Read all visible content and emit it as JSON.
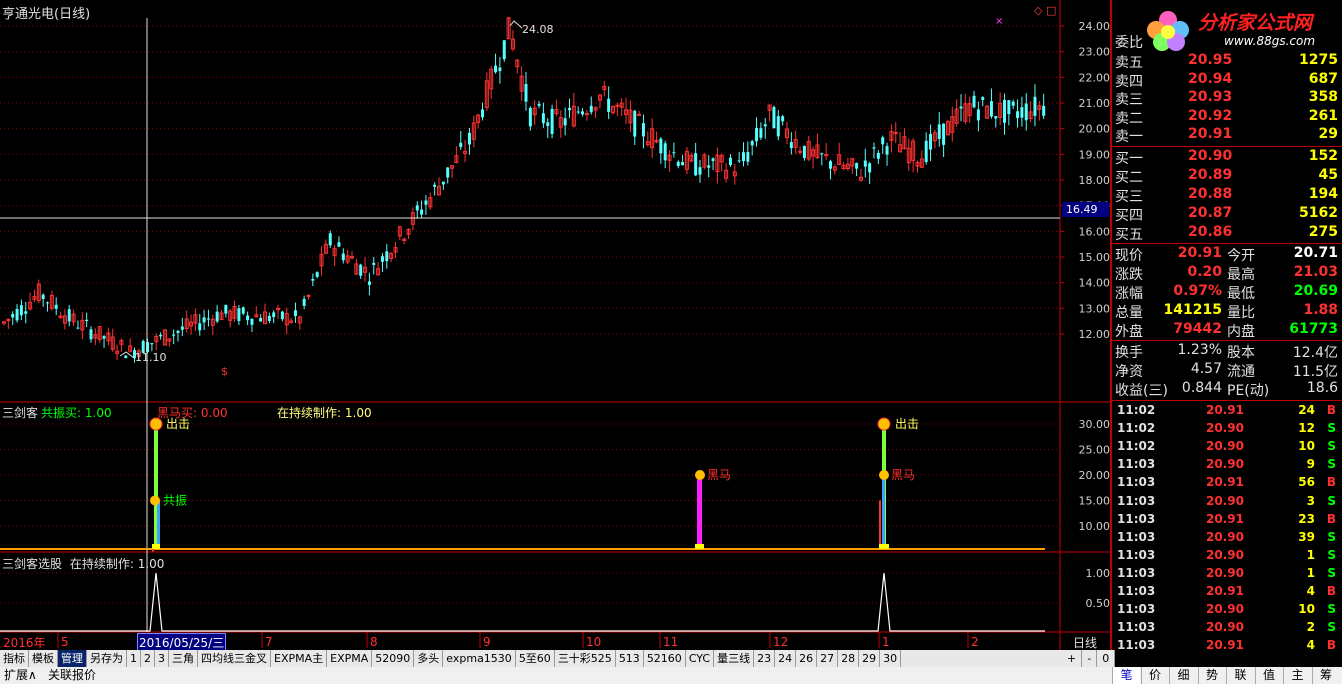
{
  "window": {
    "stock_title": "亨通光电(日线)",
    "right_marks": "◇ □",
    "logo_text": "分析家公式网",
    "logo_url": "www.88gs.com"
  },
  "price_chart": {
    "y_ticks": [
      "24.00",
      "23.00",
      "22.00",
      "21.00",
      "20.00",
      "19.00",
      "18.00",
      "17.00",
      "16.00",
      "15.00",
      "14.00",
      "13.00",
      "12.00"
    ],
    "cursor_price": "16.49",
    "high_label": "24.08",
    "low_label": "11.10",
    "dollar_mark": "$"
  },
  "ind1": {
    "name": "三剑客",
    "lines": [
      {
        "label": "共振买:",
        "value": "1.00"
      },
      {
        "label": "黑马买:",
        "value": "0.00"
      },
      {
        "label": "在持续制作:",
        "value": "1.00"
      }
    ],
    "y_ticks": [
      "30.00",
      "25.00",
      "20.00",
      "15.00",
      "10.00"
    ],
    "signals": [
      "出击",
      "共振",
      "黑马",
      "出击",
      "黑马"
    ]
  },
  "ind2": {
    "name": "三剑客选股",
    "line_label": "在持续制作:",
    "line_value": "1.00",
    "y_ticks": [
      "1.00",
      "0.50"
    ]
  },
  "date_axis": {
    "year": "2016年",
    "months": [
      "5",
      "7",
      "8",
      "9",
      "10",
      "11",
      "12",
      "1",
      "2"
    ],
    "cursor_date": "2016/05/25/三",
    "period": "日线"
  },
  "order_book": {
    "header": "委比",
    "asks": [
      {
        "label": "卖五",
        "price": "20.95",
        "vol": "1275"
      },
      {
        "label": "卖四",
        "price": "20.94",
        "vol": "687"
      },
      {
        "label": "卖三",
        "price": "20.93",
        "vol": "358"
      },
      {
        "label": "卖二",
        "price": "20.92",
        "vol": "261"
      },
      {
        "label": "卖一",
        "price": "20.91",
        "vol": "29"
      }
    ],
    "bids": [
      {
        "label": "买一",
        "price": "20.90",
        "vol": "152"
      },
      {
        "label": "买二",
        "price": "20.89",
        "vol": "45"
      },
      {
        "label": "买三",
        "price": "20.88",
        "vol": "194"
      },
      {
        "label": "买四",
        "price": "20.87",
        "vol": "5162"
      },
      {
        "label": "买五",
        "price": "20.86",
        "vol": "275"
      }
    ]
  },
  "stats": [
    {
      "l1": "现价",
      "v1": "20.91",
      "l2": "今开",
      "v2": "20.71",
      "c1": "#ff3030",
      "c2": "#ffffff"
    },
    {
      "l1": "涨跌",
      "v1": "0.20",
      "l2": "最高",
      "v2": "21.03",
      "c1": "#ff3030",
      "c2": "#ff3030"
    },
    {
      "l1": "涨幅",
      "v1": "0.97%",
      "l2": "最低",
      "v2": "20.69",
      "c1": "#ff3030",
      "c2": "#00ff00"
    },
    {
      "l1": "总量",
      "v1": "141215",
      "l2": "量比",
      "v2": "1.88",
      "c1": "#ffff00",
      "c2": "#ff3030"
    },
    {
      "l1": "外盘",
      "v1": "79442",
      "l2": "内盘",
      "v2": "61773",
      "c1": "#ff3030",
      "c2": "#00ff00"
    }
  ],
  "stats2": [
    {
      "l1": "换手",
      "v1": "1.23%",
      "l2": "股本",
      "v2": "12.4亿"
    },
    {
      "l1": "净资",
      "v1": "4.57",
      "l2": "流通",
      "v2": "11.5亿"
    },
    {
      "l1": "收益(三)",
      "v1": "0.844",
      "l2": "PE(动)",
      "v2": "18.6"
    }
  ],
  "ticks": [
    {
      "time": "11:02",
      "price": "20.91",
      "vol": "24",
      "side": "B"
    },
    {
      "time": "11:02",
      "price": "20.90",
      "vol": "12",
      "side": "S"
    },
    {
      "time": "11:02",
      "price": "20.90",
      "vol": "10",
      "side": "S"
    },
    {
      "time": "11:03",
      "price": "20.90",
      "vol": "9",
      "side": "S"
    },
    {
      "time": "11:03",
      "price": "20.91",
      "vol": "56",
      "side": "B"
    },
    {
      "time": "11:03",
      "price": "20.90",
      "vol": "3",
      "side": "S"
    },
    {
      "time": "11:03",
      "price": "20.91",
      "vol": "23",
      "side": "B"
    },
    {
      "time": "11:03",
      "price": "20.90",
      "vol": "39",
      "side": "S"
    },
    {
      "time": "11:03",
      "price": "20.90",
      "vol": "1",
      "side": "S"
    },
    {
      "time": "11:03",
      "price": "20.90",
      "vol": "1",
      "side": "S"
    },
    {
      "time": "11:03",
      "price": "20.91",
      "vol": "4",
      "side": "B"
    },
    {
      "time": "11:03",
      "price": "20.90",
      "vol": "10",
      "side": "S"
    },
    {
      "time": "11:03",
      "price": "20.90",
      "vol": "2",
      "side": "S"
    },
    {
      "time": "11:03",
      "price": "20.91",
      "vol": "4",
      "side": "B"
    }
  ],
  "toolbar": [
    "指标",
    "模板",
    "管理",
    "另存为",
    "1",
    "2",
    "3",
    "三角",
    "四均线三金叉",
    "EXPMA主",
    "EXPMA",
    "52090",
    "多头",
    "expma1530",
    "5至60",
    "三十彩525",
    "513",
    "52160",
    "CYC",
    "量三线",
    "23",
    "24",
    "26",
    "27",
    "28",
    "29",
    "30"
  ],
  "toolbar_active": "管理",
  "toolbar_right": [
    "+",
    "-",
    "0"
  ],
  "bottom": {
    "left": [
      "扩展∧",
      "关联报价"
    ],
    "tabs": [
      "笔",
      "价",
      "细",
      "势",
      "联",
      "值",
      "主",
      "筹"
    ]
  },
  "colors": {
    "up": "#ff3232",
    "down": "#54ffff",
    "grid": "#8b0000",
    "axis": "#c00000",
    "price": "#ff3030",
    "green": "#00ff00",
    "yellow": "#ffff00"
  }
}
